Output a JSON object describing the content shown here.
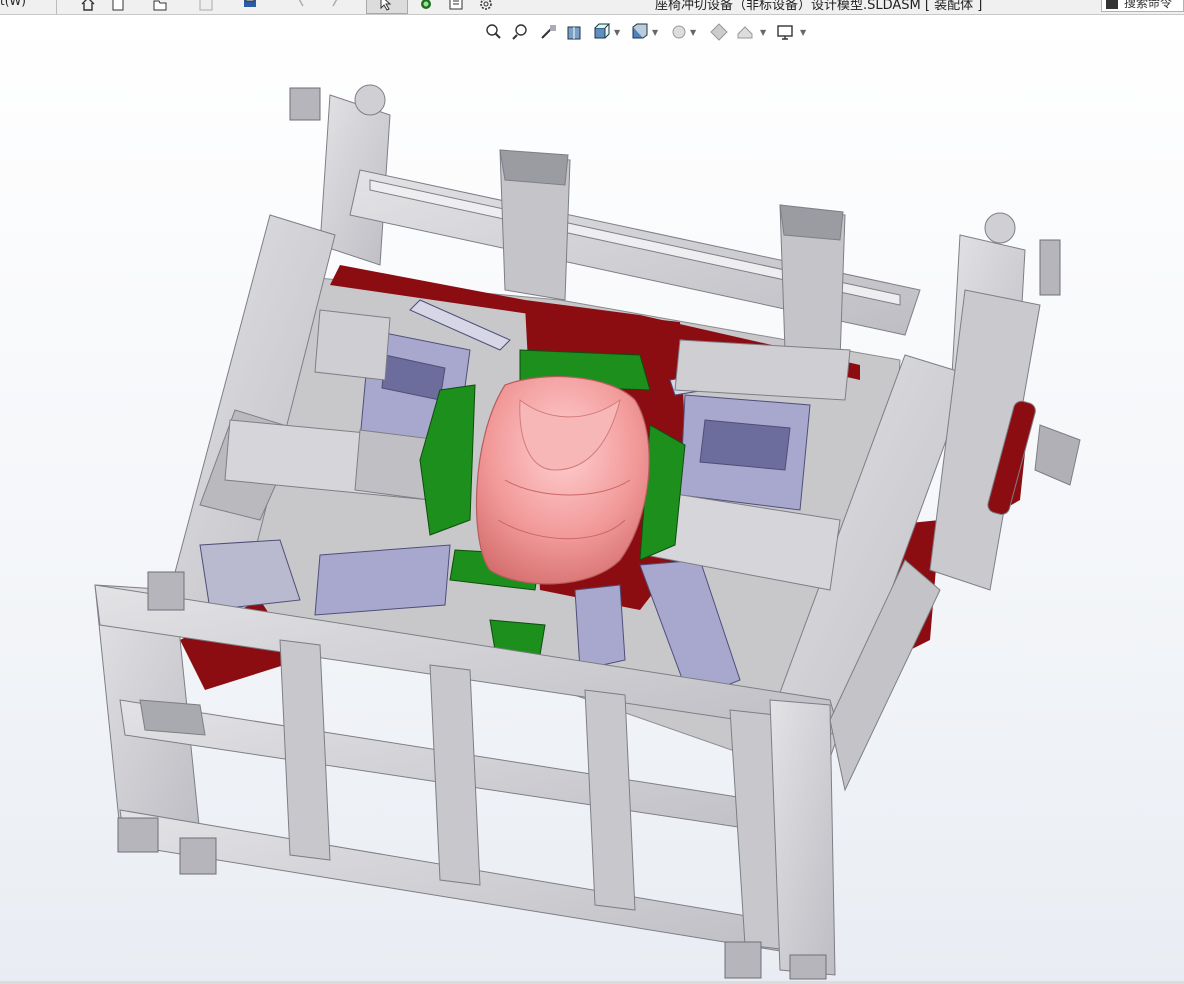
{
  "app": {
    "menu_fragment": "t(W)",
    "document_title": "座椅冲切设备（非标设备）设计模型.SLDASM [ 装配体 ]",
    "search_placeholder": "搜索命令"
  },
  "toolbar": {
    "icons": [
      "home-icon",
      "new-document-icon",
      "open-icon",
      "save-icon",
      "print-icon",
      "undo-icon",
      "redo-icon",
      "select-icon",
      "traffic-light-icon",
      "file-properties-icon",
      "options-gear-icon"
    ]
  },
  "heads_up_toolbar": {
    "icons": [
      "zoom-to-fit-icon",
      "zoom-to-area-icon",
      "previous-view-icon",
      "section-view-icon",
      "view-orientation-icon",
      "display-style-icon",
      "hide-show-items-icon",
      "edit-appearance-icon",
      "apply-scene-icon",
      "view-settings-icon"
    ]
  },
  "colors": {
    "frame": "#d2d2d6",
    "frame_shade": "#a9a9b0",
    "frame_dark": "#7e7e86",
    "base_plate": "#8b0d12",
    "clamp_blue": "#a8a8cf",
    "clamp_blue_dark": "#6d6d9d",
    "fixture_green": "#1c8f1c",
    "seat_pink": "#f3a3a3",
    "seat_pink_dark": "#d97878"
  }
}
